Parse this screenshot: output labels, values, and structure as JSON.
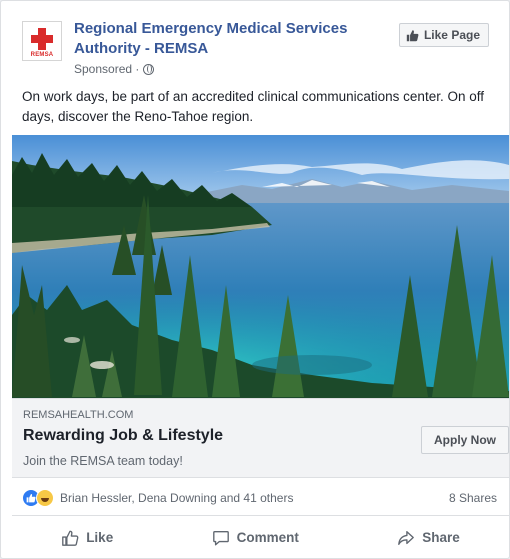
{
  "post": {
    "page_name": "Regional Emergency Medical Services Authority - REMSA",
    "sponsored": "Sponsored ·",
    "logo_text": "REMSA",
    "like_page_label": "Like Page",
    "body_text": "On work days, be part of an accredited clinical communications center. On off days, discover the Reno-Tahoe region."
  },
  "link": {
    "domain": "REMSAHEALTH.COM",
    "headline": "Rewarding Job & Lifestyle",
    "description": "Join the REMSA team today!",
    "cta_label": "Apply Now"
  },
  "engagement": {
    "reaction_names": "Brian Hessler, Dena Downing and 41 others",
    "shares": "8 Shares"
  },
  "actions": {
    "like": "Like",
    "comment": "Comment",
    "share": "Share"
  },
  "colors": {
    "link_blue": "#385898",
    "like_blue": "#2e7bf2",
    "logo_red": "#d92b2b"
  }
}
